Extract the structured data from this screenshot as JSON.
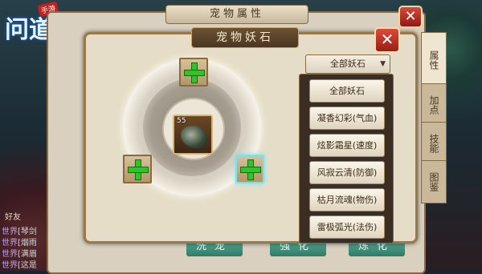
{
  "game": {
    "logo_text": "问道",
    "logo_tag": "手游",
    "friend_label": "好友",
    "chat": [
      {
        "channel": "世界",
        "text": "[琴剑"
      },
      {
        "channel": "世界",
        "text": "[烟雨"
      },
      {
        "channel": "世界",
        "text": "[满眉"
      },
      {
        "channel": "世界",
        "text": "[这是"
      }
    ]
  },
  "outer_panel": {
    "title": "宠物属性",
    "close_label": "✕",
    "tabs": [
      {
        "label": "属性",
        "active": true
      },
      {
        "label": "加点",
        "active": false
      },
      {
        "label": "技能",
        "active": false
      },
      {
        "label": "图鉴",
        "active": false
      }
    ],
    "bottom_buttons": [
      "洗宠",
      "强化",
      "炼化"
    ]
  },
  "inner_panel": {
    "title": "宠物妖石",
    "close_label": "✕",
    "pet": {
      "level": "55",
      "icon": "pet-portrait"
    },
    "plus_slots": [
      {
        "icon": "green-plus-icon",
        "selected": false
      },
      {
        "icon": "green-plus-icon",
        "selected": false
      },
      {
        "icon": "green-plus-icon",
        "selected": true
      }
    ],
    "filter": {
      "selected": "全部妖石",
      "arrow": "▼",
      "options": [
        "全部妖石",
        "凝香幻彩(气血)",
        "炫影霜星(速度)",
        "风寂云清(防御)",
        "枯月流魂(物伤)",
        "雷极弧光(法伤)"
      ]
    }
  },
  "colors": {
    "accent_green": "#2fc42a",
    "close_red": "#c52d20",
    "select_cyan": "#6fe6f5"
  }
}
